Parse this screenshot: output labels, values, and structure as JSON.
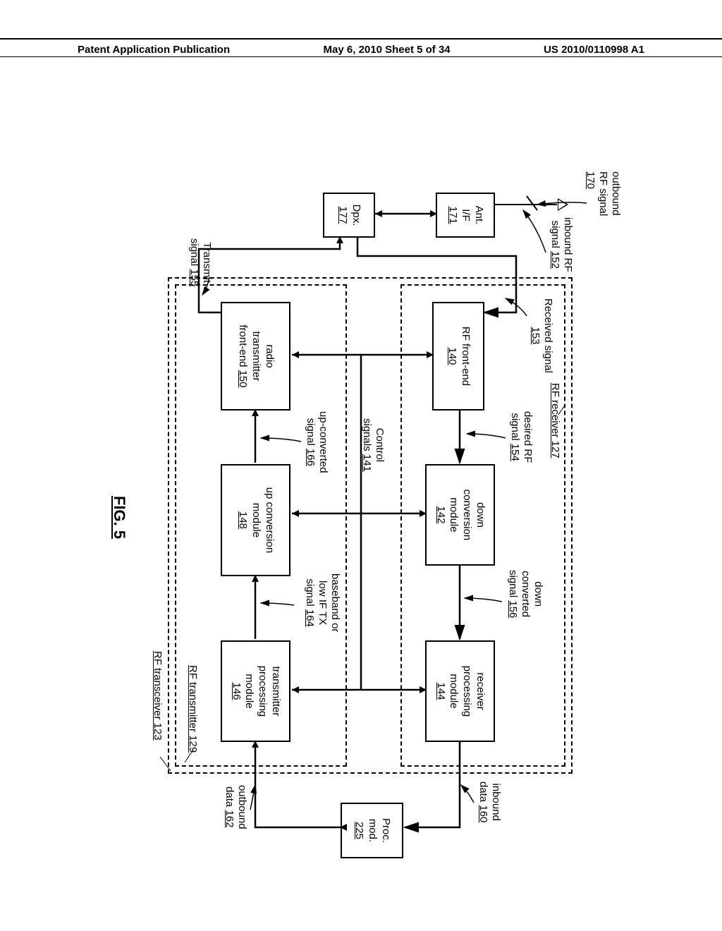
{
  "header": {
    "left": "Patent Application Publication",
    "center": "May 6, 2010  Sheet 5 of 34",
    "right": "US 2010/0110998 A1"
  },
  "figure_title": "FIG. 5",
  "labels": {
    "outbound_rf_signal_a": "outbound",
    "outbound_rf_signal_b": "RF signal",
    "outbound_rf_signal_n": "170",
    "inbound_rf_a": "inbound RF",
    "inbound_rf_b": "signal",
    "inbound_rf_n": "152",
    "received_signal": "Received signal",
    "received_signal_n": "153",
    "rf_receiver": "RF receiver",
    "rf_receiver_n": "127",
    "desired_rf_a": "desired RF",
    "desired_rf_b": "signal",
    "desired_rf_n": "154",
    "down_conv_a": "down",
    "down_conv_b": "converted",
    "down_conv_c": "signal",
    "down_conv_n": "156",
    "inbound_data_a": "inbound",
    "inbound_data_b": "data",
    "inbound_data_n": "160",
    "control_sig_a": "Control",
    "control_sig_b": "signals",
    "control_sig_n": "141",
    "baseband_a": "baseband or",
    "baseband_b": "low IF TX",
    "baseband_c": "signal",
    "baseband_n": "164",
    "upconv_sig_a": "up-converted",
    "upconv_sig_b": "signal",
    "upconv_sig_n": "166",
    "transmit_sig_a": "Transmit",
    "transmit_sig_b": "signal",
    "transmit_sig_n": "155",
    "outbound_data_a": "outbound",
    "outbound_data_b": "data",
    "outbound_data_n": "162",
    "rf_transmitter": "RF transmitter",
    "rf_transmitter_n": "129",
    "rf_transceiver": "RF transceiver",
    "rf_transceiver_n": "123"
  },
  "boxes": {
    "ant_if_a": "Ant.",
    "ant_if_b": "I/F",
    "ant_if_n": "171",
    "dpx_a": "Dpx.",
    "dpx_n": "177",
    "rf_fe_a": "RF front-end",
    "rf_fe_n": "140",
    "down_mod_a": "down",
    "down_mod_b": "conversion",
    "down_mod_c": "module",
    "down_mod_n": "142",
    "rx_proc_a": "receiver",
    "rx_proc_b": "processing",
    "rx_proc_c": "module",
    "rx_proc_n": "144",
    "proc_a": "Proc.",
    "proc_b": "mod.",
    "proc_n": "225",
    "radio_tx_a": "radio",
    "radio_tx_b": "transmitter",
    "radio_tx_c": "front-end",
    "radio_tx_n": "150",
    "up_mod_a": "up conversion",
    "up_mod_b": "module",
    "up_mod_n": "148",
    "tx_proc_a": "transmitter",
    "tx_proc_b": "processing",
    "tx_proc_c": "module",
    "tx_proc_n": "146"
  }
}
